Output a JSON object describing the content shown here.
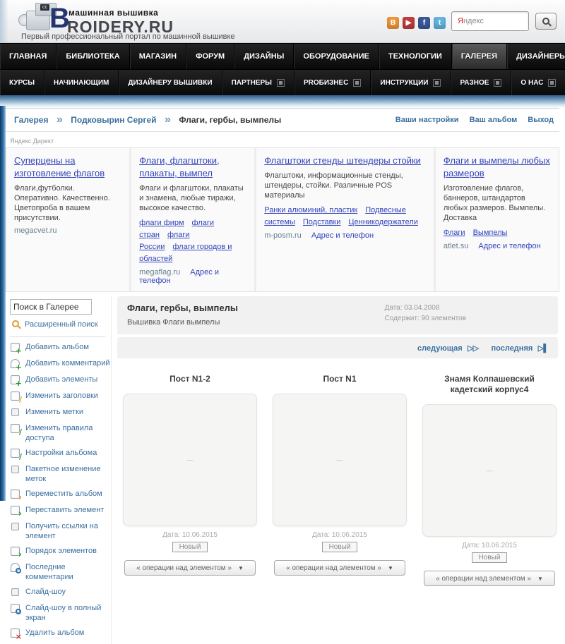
{
  "header": {
    "logo": {
      "badge": "cc",
      "brand_b": "B",
      "brand_top": "машинная вышивка",
      "brand_rest": "ROIDERY.RU",
      "tagline": "Первый профессиональный портал по машинной вышивке"
    },
    "social": [
      {
        "name": "blogger-icon",
        "glyph": "B",
        "style": "background:#f0973a"
      },
      {
        "name": "youtube-icon",
        "glyph": "▶",
        "style": "background:#c23c3c"
      },
      {
        "name": "facebook-icon",
        "glyph": "f",
        "style": "background:#3b5998"
      },
      {
        "name": "twitter-icon",
        "glyph": "t",
        "style": "background:#64b5e1"
      }
    ],
    "search": {
      "value": "Яндекс"
    }
  },
  "nav": {
    "row1": [
      {
        "label": "ГЛАВНАЯ",
        "active": false
      },
      {
        "label": "БИБЛИОТЕКА",
        "active": false
      },
      {
        "label": "МАГАЗИН",
        "active": false
      },
      {
        "label": "ФОРУМ",
        "active": false
      },
      {
        "label": "ДИЗАЙНЫ",
        "active": false
      },
      {
        "label": "ОБОРУДОВАНИЕ",
        "active": false
      },
      {
        "label": "ТЕХНОЛОГИИ",
        "active": false
      },
      {
        "label": "ГАЛЕРЕЯ",
        "active": true
      },
      {
        "label": "ДИЗАЙНЕРЫ",
        "active": false
      }
    ],
    "row2": [
      {
        "label": "КУРСЫ",
        "dropdown": false
      },
      {
        "label": "НАЧИНАЮЩИМ",
        "dropdown": false
      },
      {
        "label": "ДИЗАЙНЕРУ ВЫШИВКИ",
        "dropdown": false
      },
      {
        "label": "ПАРТНЕРЫ",
        "dropdown": true
      },
      {
        "label": "PROБИЗНЕС",
        "dropdown": true
      },
      {
        "label": "ИНСТРУКЦИИ",
        "dropdown": true
      },
      {
        "label": "РАЗНОЕ",
        "dropdown": true
      },
      {
        "label": "О НАС",
        "dropdown": true
      }
    ]
  },
  "breadcrumb": {
    "items": [
      {
        "label": "Галерея",
        "current": false,
        "link": true
      },
      {
        "label": "Подковырин Сергей",
        "current": false,
        "link": true
      },
      {
        "label": "Флаги, гербы, вымпелы",
        "current": true,
        "link": false
      }
    ]
  },
  "user_links": [
    "Ваши настройки",
    "Ваш альбом",
    "Выход"
  ],
  "ads": {
    "label": "Яндекс Директ",
    "items": [
      {
        "title": "Суперцены на изготовление флагов",
        "body": "Флаги,футболки. Оперативно. Качественно. Цветопроба в вашем присутствии.",
        "links": [],
        "domain": "megacvet.ru",
        "contact": ""
      },
      {
        "title": "Флаги, флагштоки, плакаты, вымпел",
        "body": "Флаги и флагштоки, плакаты и знамена, любые тиражи, высокое качество.",
        "links": [
          "флаги фирм",
          "флаги стран",
          "флаги России",
          "флаги городов и областей"
        ],
        "domain": "megaflag.ru",
        "contact": "Адрес и телефон"
      },
      {
        "title": "Флагштоки стенды штендеры стойки",
        "body": "Флагштоки, информационные стенды, штендеры, стойки. Различные POS материалы",
        "links": [
          "Ранки алюминий, пластик",
          "Подвесные системы",
          "Подставки",
          "Ценникодержатели"
        ],
        "domain": "m-posm.ru",
        "contact": "Адрес и телефон"
      },
      {
        "title": "Флаги и вымпелы любых размеров",
        "body": "Изготовление флагов, баннеров, штандартов любых размеров. Вымпелы. Доставка",
        "links": [
          "Флаги",
          "Вымпелы"
        ],
        "domain": "atlet.su",
        "contact": "Адрес и телефон"
      }
    ]
  },
  "sidebar": {
    "search_value": "Поиск в Галерее",
    "advanced": "Расширенный поиск",
    "menu": [
      {
        "icon": "add-album-icon",
        "label": "Добавить альбом"
      },
      {
        "icon": "add-comment-icon",
        "label": "Добавить комментарий"
      },
      {
        "icon": "add-elements-icon",
        "label": "Добавить элементы"
      },
      {
        "icon": "edit-titles-icon",
        "label": "Изменить заголовки"
      },
      {
        "icon": "edit-labels-icon",
        "label": "Изменить метки"
      },
      {
        "icon": "edit-access-icon",
        "label": "Изменить правила доступа"
      },
      {
        "icon": "album-settings-icon",
        "label": "Настройки альбома"
      },
      {
        "icon": "batch-labels-icon",
        "label": "Пакетное изменение меток"
      },
      {
        "icon": "move-album-icon",
        "label": "Переместить альбом"
      },
      {
        "icon": "move-element-icon",
        "label": "Переставить элемент"
      },
      {
        "icon": "get-links-icon",
        "label": "Получить ссылки на элемент"
      },
      {
        "icon": "element-order-icon",
        "label": "Порядок элементов"
      },
      {
        "icon": "recent-comments-icon",
        "label": "Последние комментарии"
      },
      {
        "icon": "slideshow-icon",
        "label": "Слайд-шоу"
      },
      {
        "icon": "fullscreen-slideshow-icon",
        "label": "Слайд-шоу в полный экран"
      },
      {
        "icon": "delete-album-icon",
        "label": "Удалить альбом"
      }
    ]
  },
  "main": {
    "title": "Флаги, гербы, вымпелы",
    "subtitle": "Вышивка Флаги вымпелы",
    "meta_date": "Дата: 03.04.2008",
    "meta_count": "Содержит: 90 элементов",
    "pagination": {
      "next": "следующая",
      "next_icon": "▷▷",
      "last": "последняя",
      "last_icon": "▷▌"
    },
    "thumb_placeholder": "—",
    "cards": [
      {
        "title": "Пост N1-2",
        "date": "Дата: 10.06.2015",
        "badge": "Новый",
        "action": "« операции над элементом »"
      },
      {
        "title": "Пост N1",
        "date": "Дата: 10.06.2015",
        "badge": "Новый",
        "action": "« операции над элементом »"
      },
      {
        "title": "Знамя Колпашевский кадетский корпус4",
        "date": "Дата: 10.06.2015",
        "badge": "Новый",
        "action": "« операции над элементом »"
      }
    ]
  }
}
